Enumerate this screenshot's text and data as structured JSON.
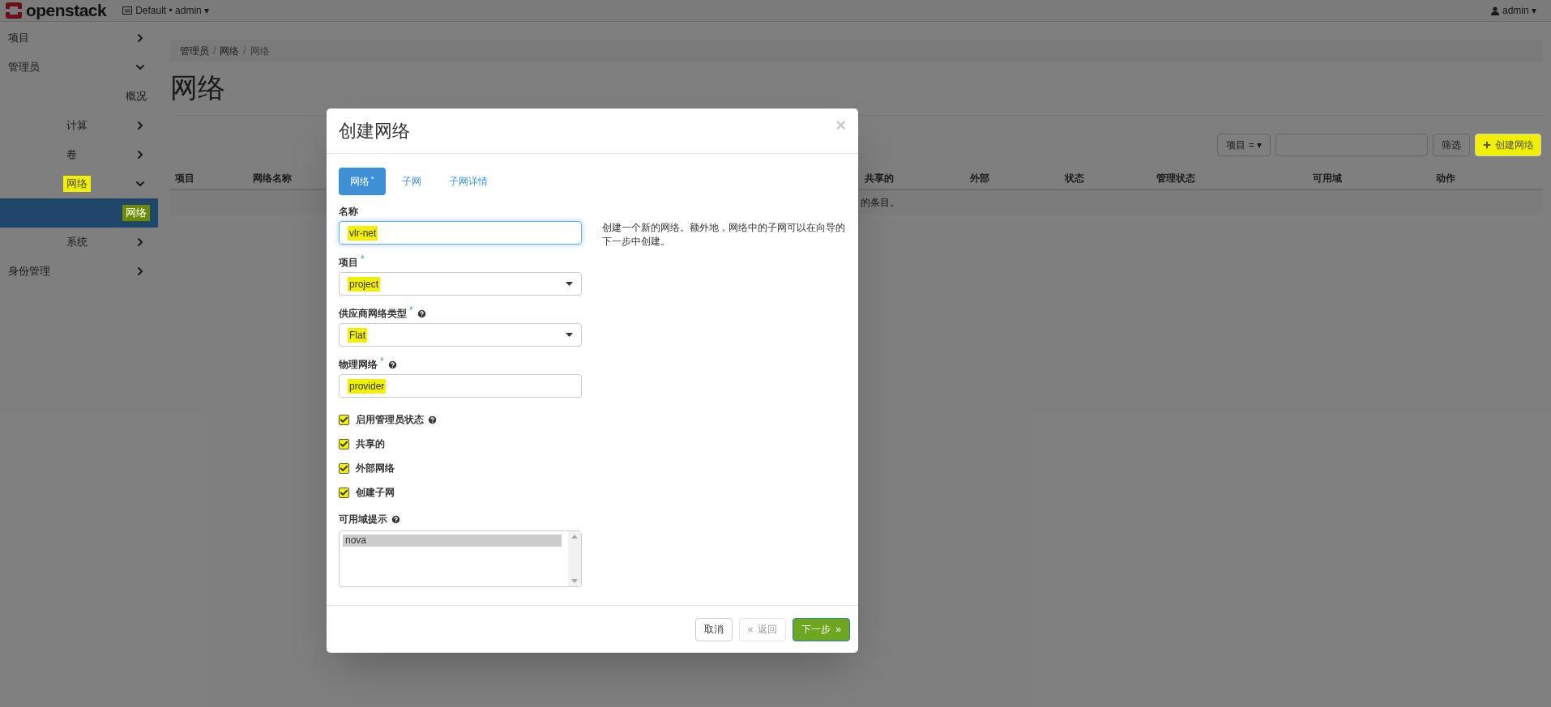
{
  "topbar": {
    "logo": "openstack",
    "project_menu": "Default • admin",
    "user_menu": "admin",
    "caret": "▾"
  },
  "sidebar": {
    "items": [
      {
        "kind": "group",
        "label": "项目",
        "expanded": false,
        "highlighted": false
      },
      {
        "kind": "group",
        "label": "管理员",
        "expanded": true,
        "highlighted": false,
        "children": [
          {
            "kind": "link",
            "label": "概况",
            "selected": false,
            "highlighted": false
          },
          {
            "kind": "group",
            "label": "计算",
            "expanded": false,
            "highlighted": false
          },
          {
            "kind": "group",
            "label": "卷",
            "expanded": false,
            "highlighted": false
          },
          {
            "kind": "group",
            "label": "网络",
            "expanded": true,
            "highlighted": true,
            "children": [
              {
                "kind": "link",
                "label": "网络",
                "selected": true,
                "highlighted": true
              }
            ]
          },
          {
            "kind": "group",
            "label": "系统",
            "expanded": false,
            "highlighted": false
          }
        ]
      },
      {
        "kind": "group",
        "label": "身份管理",
        "expanded": false,
        "highlighted": false
      }
    ]
  },
  "breadcrumb": [
    "管理员",
    "网络",
    "网络"
  ],
  "breadcrumb_separator": "/",
  "page_title": "网络",
  "toolbar": {
    "filter_menu": "项目 =",
    "caret": "▾",
    "filter_button": "筛选",
    "create_button": {
      "label": "创建网络",
      "highlighted": true
    }
  },
  "table": {
    "columns": [
      {
        "label": "项目"
      },
      {
        "label": "网络名称"
      },
      {
        "label": "共享的"
      },
      {
        "label": "外部"
      },
      {
        "label": "状态"
      },
      {
        "label": "管理状态"
      },
      {
        "label": "可用域"
      },
      {
        "label": "动作"
      }
    ],
    "empty_message": "的条目。"
  },
  "modal": {
    "title": "创建网络",
    "close": "×",
    "required_mark": "*",
    "tabs": [
      {
        "label": "网络",
        "required": true,
        "selected": true
      },
      {
        "label": "子网",
        "required": false,
        "selected": false
      },
      {
        "label": "子网详情",
        "required": false,
        "selected": false
      }
    ],
    "description": "创建一个新的网络。额外地，网络中的子网可以在向导的下一步中创建。",
    "fields": [
      {
        "kind": "text",
        "label": "名称",
        "required": false,
        "help": false,
        "value": "vlr-net",
        "focused": true,
        "highlighted": true
      },
      {
        "kind": "select",
        "label": "项目",
        "required": true,
        "help": false,
        "value": "project",
        "focused": false,
        "highlighted": true
      },
      {
        "kind": "select",
        "label": "供应商网络类型",
        "required": true,
        "help": true,
        "value": "Flat",
        "focused": false,
        "highlighted": true
      },
      {
        "kind": "text",
        "label": "物理网络",
        "required": true,
        "help": true,
        "value": "provider",
        "focused": false,
        "highlighted": true
      }
    ],
    "checkboxes": [
      {
        "label": "启用管理员状态",
        "checked": true,
        "help": true,
        "highlighted": true
      },
      {
        "label": "共享的",
        "checked": true,
        "help": false,
        "highlighted": true
      },
      {
        "label": "外部网络",
        "checked": true,
        "help": false,
        "highlighted": true
      },
      {
        "label": "创建子网",
        "checked": true,
        "help": false,
        "highlighted": true
      }
    ],
    "availability_zone": {
      "label": "可用域提示",
      "help": true,
      "options": [
        {
          "label": "nova",
          "selected": true
        }
      ]
    },
    "buttons": [
      {
        "kind": "default",
        "label": "取消",
        "disabled": false,
        "highlighted": false
      },
      {
        "kind": "back",
        "label": "返回",
        "prefix": "«",
        "disabled": true,
        "highlighted": false
      },
      {
        "kind": "next",
        "label": "下一步",
        "suffix": "»",
        "disabled": false,
        "highlighted": true
      }
    ]
  }
}
